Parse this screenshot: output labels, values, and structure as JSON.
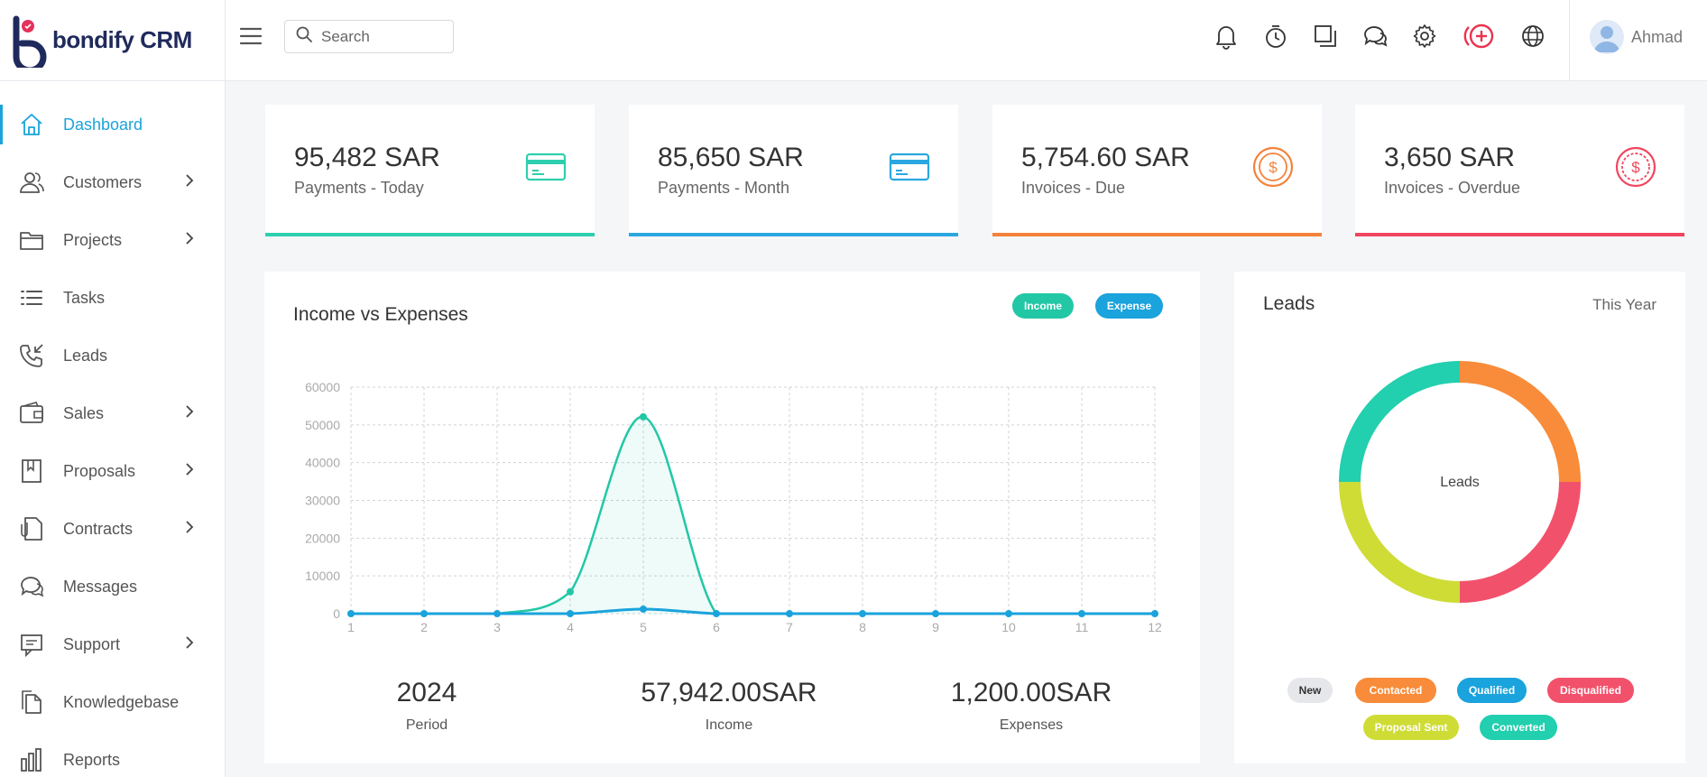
{
  "app": {
    "brand": "bondify CRM"
  },
  "search": {
    "placeholder": "Search"
  },
  "user": {
    "name": "Ahmad"
  },
  "sidebar": {
    "items": [
      {
        "label": "Dashboard",
        "icon": "home-icon",
        "active": true,
        "chevron": false
      },
      {
        "label": "Customers",
        "icon": "users-icon",
        "chevron": true
      },
      {
        "label": "Projects",
        "icon": "folder-icon",
        "chevron": true
      },
      {
        "label": "Tasks",
        "icon": "list-icon",
        "chevron": false
      },
      {
        "label": "Leads",
        "icon": "phone-incoming-icon",
        "chevron": false
      },
      {
        "label": "Sales",
        "icon": "wallet-icon",
        "chevron": true
      },
      {
        "label": "Proposals",
        "icon": "bookmark-icon",
        "chevron": true
      },
      {
        "label": "Contracts",
        "icon": "contract-icon",
        "chevron": true
      },
      {
        "label": "Messages",
        "icon": "chat-icon",
        "chevron": false
      },
      {
        "label": "Support",
        "icon": "support-icon",
        "chevron": true
      },
      {
        "label": "Knowledgebase",
        "icon": "documents-icon",
        "chevron": false
      },
      {
        "label": "Reports",
        "icon": "bar-chart-icon",
        "chevron": false
      }
    ]
  },
  "header_icons": [
    "bell-icon",
    "timer-icon",
    "windows-icon",
    "chat-icon",
    "gear-icon",
    "add-circle-icon",
    "globe-icon"
  ],
  "cards": [
    {
      "amount": "95,482 SAR",
      "caption": "Payments - Today",
      "icon": "credit-card-icon",
      "color": "#2ecfae"
    },
    {
      "amount": "85,650 SAR",
      "caption": "Payments - Month",
      "icon": "credit-card-icon",
      "color": "#2aa7e0"
    },
    {
      "amount": "5,754.60 SAR",
      "caption": "Invoices - Due",
      "icon": "dollar-coin-icon",
      "color": "#f4823a"
    },
    {
      "amount": "3,650 SAR",
      "caption": "Invoices - Overdue",
      "icon": "dollar-coin-icon",
      "color": "#f0455e"
    }
  ],
  "income_panel": {
    "title": "Income vs Expenses",
    "legend": [
      {
        "label": "Income",
        "color": "#22c7a6"
      },
      {
        "label": "Expense",
        "color": "#1aa3dc"
      }
    ],
    "summary": [
      {
        "value": "2024",
        "label": "Period"
      },
      {
        "value": "57,942.00SAR",
        "label": "Income"
      },
      {
        "value": "1,200.00SAR",
        "label": "Expenses"
      }
    ]
  },
  "leads_panel": {
    "title": "Leads",
    "period": "This Year",
    "center_label": "Leads",
    "legend": [
      {
        "label": "New",
        "color": "#e6e7ea",
        "text_color": "#333"
      },
      {
        "label": "Contacted",
        "color": "#f88c3a",
        "text_color": "#fff"
      },
      {
        "label": "Qualified",
        "color": "#1aa3dc",
        "text_color": "#fff"
      },
      {
        "label": "Disqualified",
        "color": "#f2516b",
        "text_color": "#fff"
      },
      {
        "label": "Proposal Sent",
        "color": "#cfdc36",
        "text_color": "#fff"
      },
      {
        "label": "Converted",
        "color": "#22cfae",
        "text_color": "#fff"
      }
    ]
  },
  "chart_data": [
    {
      "type": "line",
      "title": "Income vs Expenses",
      "x": [
        1,
        2,
        3,
        4,
        5,
        6,
        7,
        8,
        9,
        10,
        11,
        12
      ],
      "ylim": [
        0,
        60000
      ],
      "yticks": [
        0,
        10000,
        20000,
        30000,
        40000,
        50000,
        60000
      ],
      "grid": true,
      "series": [
        {
          "name": "Income",
          "color": "#22c7a6",
          "values": [
            0,
            0,
            0,
            5800,
            52142,
            0,
            0,
            0,
            0,
            0,
            0,
            0
          ]
        },
        {
          "name": "Expense",
          "color": "#1aa3dc",
          "values": [
            0,
            0,
            0,
            0,
            1200,
            0,
            0,
            0,
            0,
            0,
            0,
            0
          ]
        }
      ]
    },
    {
      "type": "pie",
      "title": "Leads",
      "categories": [
        "Contacted",
        "Disqualified",
        "Proposal Sent",
        "Converted"
      ],
      "values": [
        1,
        1,
        1,
        1
      ],
      "colors": [
        "#f88c3a",
        "#f2516b",
        "#cfdc36",
        "#22cfae"
      ]
    }
  ]
}
